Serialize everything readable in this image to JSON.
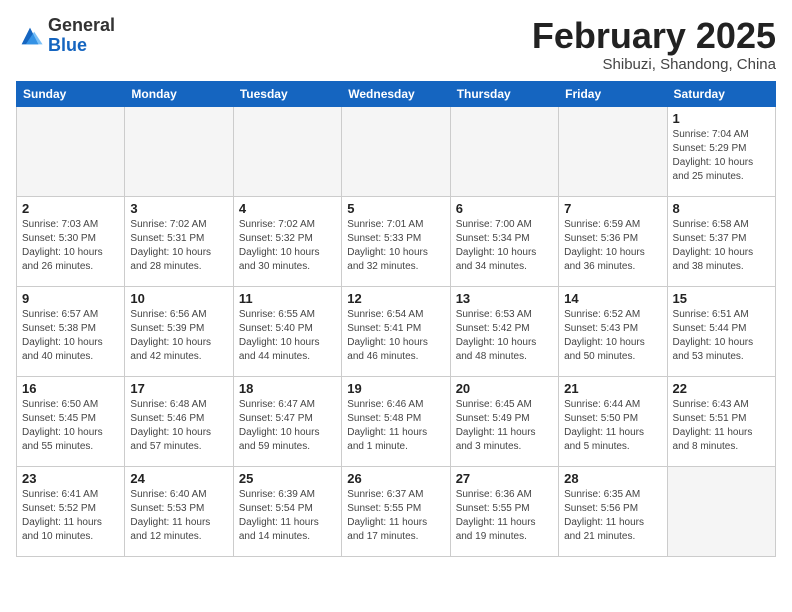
{
  "header": {
    "logo_general": "General",
    "logo_blue": "Blue",
    "title": "February 2025",
    "subtitle": "Shibuzi, Shandong, China"
  },
  "weekdays": [
    "Sunday",
    "Monday",
    "Tuesday",
    "Wednesday",
    "Thursday",
    "Friday",
    "Saturday"
  ],
  "weeks": [
    [
      {
        "day": "",
        "info": ""
      },
      {
        "day": "",
        "info": ""
      },
      {
        "day": "",
        "info": ""
      },
      {
        "day": "",
        "info": ""
      },
      {
        "day": "",
        "info": ""
      },
      {
        "day": "",
        "info": ""
      },
      {
        "day": "1",
        "info": "Sunrise: 7:04 AM\nSunset: 5:29 PM\nDaylight: 10 hours\nand 25 minutes."
      }
    ],
    [
      {
        "day": "2",
        "info": "Sunrise: 7:03 AM\nSunset: 5:30 PM\nDaylight: 10 hours\nand 26 minutes."
      },
      {
        "day": "3",
        "info": "Sunrise: 7:02 AM\nSunset: 5:31 PM\nDaylight: 10 hours\nand 28 minutes."
      },
      {
        "day": "4",
        "info": "Sunrise: 7:02 AM\nSunset: 5:32 PM\nDaylight: 10 hours\nand 30 minutes."
      },
      {
        "day": "5",
        "info": "Sunrise: 7:01 AM\nSunset: 5:33 PM\nDaylight: 10 hours\nand 32 minutes."
      },
      {
        "day": "6",
        "info": "Sunrise: 7:00 AM\nSunset: 5:34 PM\nDaylight: 10 hours\nand 34 minutes."
      },
      {
        "day": "7",
        "info": "Sunrise: 6:59 AM\nSunset: 5:36 PM\nDaylight: 10 hours\nand 36 minutes."
      },
      {
        "day": "8",
        "info": "Sunrise: 6:58 AM\nSunset: 5:37 PM\nDaylight: 10 hours\nand 38 minutes."
      }
    ],
    [
      {
        "day": "9",
        "info": "Sunrise: 6:57 AM\nSunset: 5:38 PM\nDaylight: 10 hours\nand 40 minutes."
      },
      {
        "day": "10",
        "info": "Sunrise: 6:56 AM\nSunset: 5:39 PM\nDaylight: 10 hours\nand 42 minutes."
      },
      {
        "day": "11",
        "info": "Sunrise: 6:55 AM\nSunset: 5:40 PM\nDaylight: 10 hours\nand 44 minutes."
      },
      {
        "day": "12",
        "info": "Sunrise: 6:54 AM\nSunset: 5:41 PM\nDaylight: 10 hours\nand 46 minutes."
      },
      {
        "day": "13",
        "info": "Sunrise: 6:53 AM\nSunset: 5:42 PM\nDaylight: 10 hours\nand 48 minutes."
      },
      {
        "day": "14",
        "info": "Sunrise: 6:52 AM\nSunset: 5:43 PM\nDaylight: 10 hours\nand 50 minutes."
      },
      {
        "day": "15",
        "info": "Sunrise: 6:51 AM\nSunset: 5:44 PM\nDaylight: 10 hours\nand 53 minutes."
      }
    ],
    [
      {
        "day": "16",
        "info": "Sunrise: 6:50 AM\nSunset: 5:45 PM\nDaylight: 10 hours\nand 55 minutes."
      },
      {
        "day": "17",
        "info": "Sunrise: 6:48 AM\nSunset: 5:46 PM\nDaylight: 10 hours\nand 57 minutes."
      },
      {
        "day": "18",
        "info": "Sunrise: 6:47 AM\nSunset: 5:47 PM\nDaylight: 10 hours\nand 59 minutes."
      },
      {
        "day": "19",
        "info": "Sunrise: 6:46 AM\nSunset: 5:48 PM\nDaylight: 11 hours\nand 1 minute."
      },
      {
        "day": "20",
        "info": "Sunrise: 6:45 AM\nSunset: 5:49 PM\nDaylight: 11 hours\nand 3 minutes."
      },
      {
        "day": "21",
        "info": "Sunrise: 6:44 AM\nSunset: 5:50 PM\nDaylight: 11 hours\nand 5 minutes."
      },
      {
        "day": "22",
        "info": "Sunrise: 6:43 AM\nSunset: 5:51 PM\nDaylight: 11 hours\nand 8 minutes."
      }
    ],
    [
      {
        "day": "23",
        "info": "Sunrise: 6:41 AM\nSunset: 5:52 PM\nDaylight: 11 hours\nand 10 minutes."
      },
      {
        "day": "24",
        "info": "Sunrise: 6:40 AM\nSunset: 5:53 PM\nDaylight: 11 hours\nand 12 minutes."
      },
      {
        "day": "25",
        "info": "Sunrise: 6:39 AM\nSunset: 5:54 PM\nDaylight: 11 hours\nand 14 minutes."
      },
      {
        "day": "26",
        "info": "Sunrise: 6:37 AM\nSunset: 5:55 PM\nDaylight: 11 hours\nand 17 minutes."
      },
      {
        "day": "27",
        "info": "Sunrise: 6:36 AM\nSunset: 5:55 PM\nDaylight: 11 hours\nand 19 minutes."
      },
      {
        "day": "28",
        "info": "Sunrise: 6:35 AM\nSunset: 5:56 PM\nDaylight: 11 hours\nand 21 minutes."
      },
      {
        "day": "",
        "info": ""
      }
    ]
  ]
}
